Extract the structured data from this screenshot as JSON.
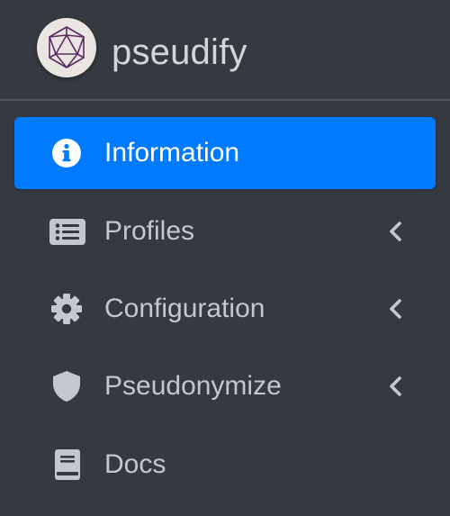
{
  "brand": {
    "name": "pseudify",
    "logo_icon": "polyhedron-logo"
  },
  "colors": {
    "sidebar_bg": "#343a40",
    "active_bg": "#007bff",
    "text_inactive": "#c2c7d0",
    "text_active": "#ffffff",
    "divider": "#4b545c"
  },
  "nav": {
    "items": [
      {
        "label": "Information",
        "icon": "info-circle-icon",
        "active": true,
        "has_submenu": false
      },
      {
        "label": "Profiles",
        "icon": "list-alt-icon",
        "active": false,
        "has_submenu": true
      },
      {
        "label": "Configuration",
        "icon": "gear-icon",
        "active": false,
        "has_submenu": true
      },
      {
        "label": "Pseudonymize",
        "icon": "shield-icon",
        "active": false,
        "has_submenu": true
      },
      {
        "label": "Docs",
        "icon": "book-icon",
        "active": false,
        "has_submenu": false
      }
    ]
  }
}
